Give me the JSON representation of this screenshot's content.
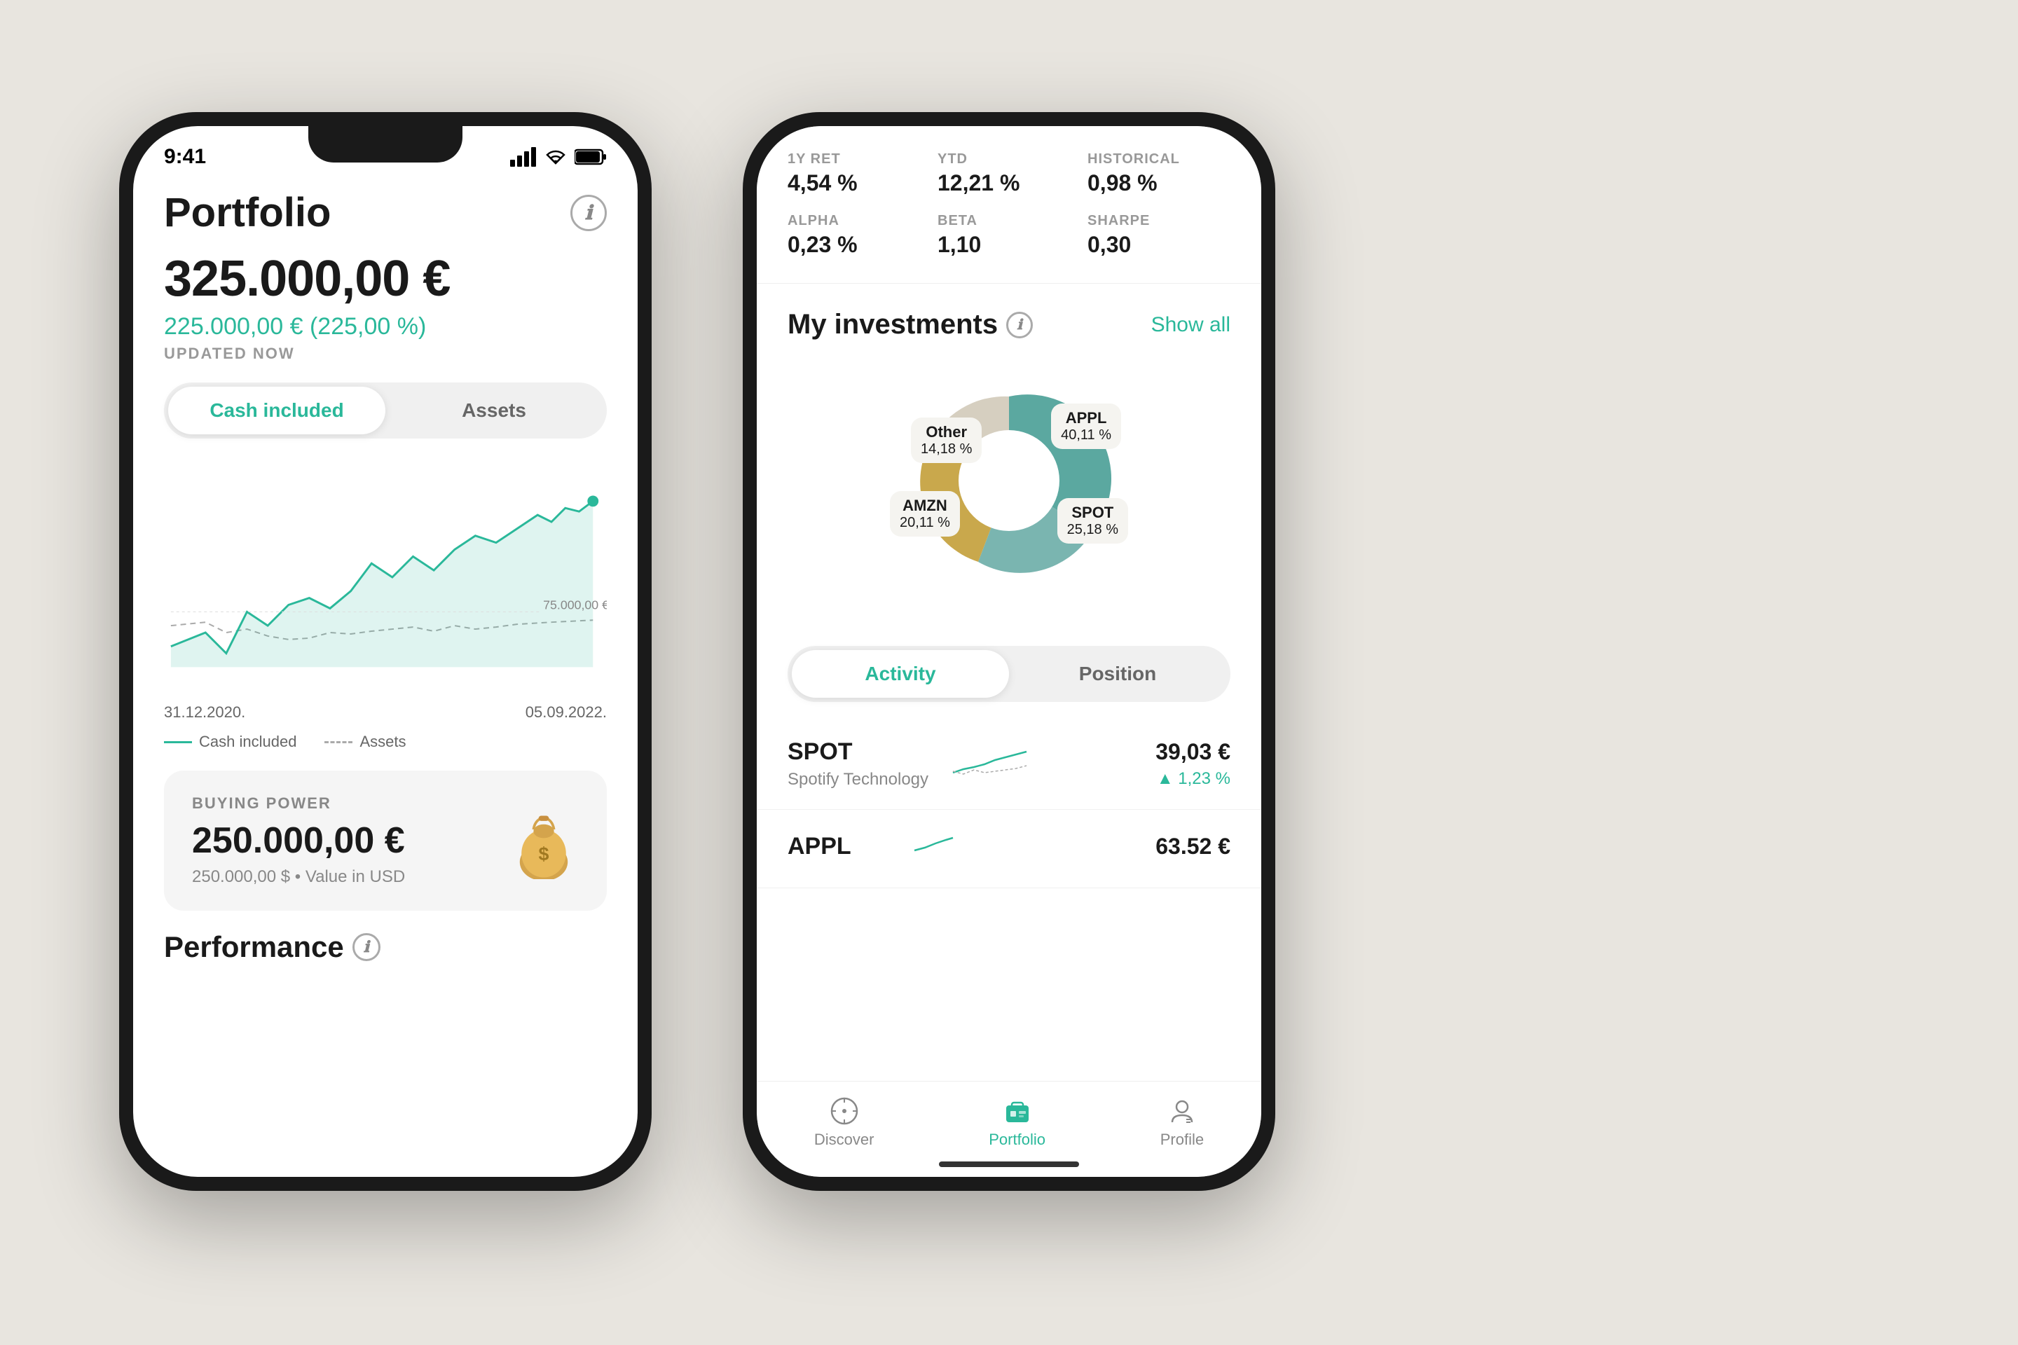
{
  "background_color": "#e8e5df",
  "left_phone": {
    "status_bar": {
      "time": "9:41"
    },
    "header": {
      "title": "Portfolio",
      "info_icon": "ℹ"
    },
    "portfolio": {
      "value": "325.000,00 €",
      "change": "225.000,00 € (225,00 %)",
      "updated": "UPDATED NOW"
    },
    "tabs": {
      "active": "Cash included",
      "inactive": "Assets"
    },
    "chart": {
      "y_label": "75.000,00 €",
      "date_start": "31.12.2020.",
      "date_end": "05.09.2022.",
      "legend_cash": "Cash included",
      "legend_assets": "Assets"
    },
    "buying_power": {
      "label": "BUYING POWER",
      "value": "250.000,00 €",
      "sub": "250.000,00 $ • Value in USD"
    },
    "performance": {
      "title": "Performance"
    }
  },
  "right_phone": {
    "stats": [
      {
        "label": "1Y RET",
        "value": "4,54 %"
      },
      {
        "label": "YTD",
        "value": "12,21 %"
      },
      {
        "label": "HISTORICAL",
        "value": "0,98 %"
      },
      {
        "label": "ALPHA",
        "value": "0,23 %"
      },
      {
        "label": "BETA",
        "value": "1,10"
      },
      {
        "label": "SHARPE",
        "value": "0,30"
      }
    ],
    "investments": {
      "title": "My investments",
      "show_all": "Show all",
      "donut": [
        {
          "ticker": "APPL",
          "pct": "40,11 %",
          "color": "#5ba8a0"
        },
        {
          "ticker": "SPOT",
          "pct": "25,18 %",
          "color": "#7ab5b0"
        },
        {
          "ticker": "AMZN",
          "pct": "20,11 %",
          "color": "#c9a84c"
        },
        {
          "ticker": "Other",
          "pct": "14,18 %",
          "color": "#d6cfc0"
        }
      ]
    },
    "activity_tabs": {
      "active": "Activity",
      "inactive": "Position"
    },
    "stocks": [
      {
        "ticker": "SPOT",
        "name": "Spotify Technology",
        "price": "39,03 €",
        "change": "▲ 1,23 %"
      },
      {
        "ticker": "APPL",
        "name": "",
        "price": "63.52 €",
        "change": ""
      }
    ],
    "bottom_nav": [
      {
        "label": "Discover",
        "active": false
      },
      {
        "label": "Portfolio",
        "active": true
      },
      {
        "label": "Profile",
        "active": false
      }
    ]
  }
}
